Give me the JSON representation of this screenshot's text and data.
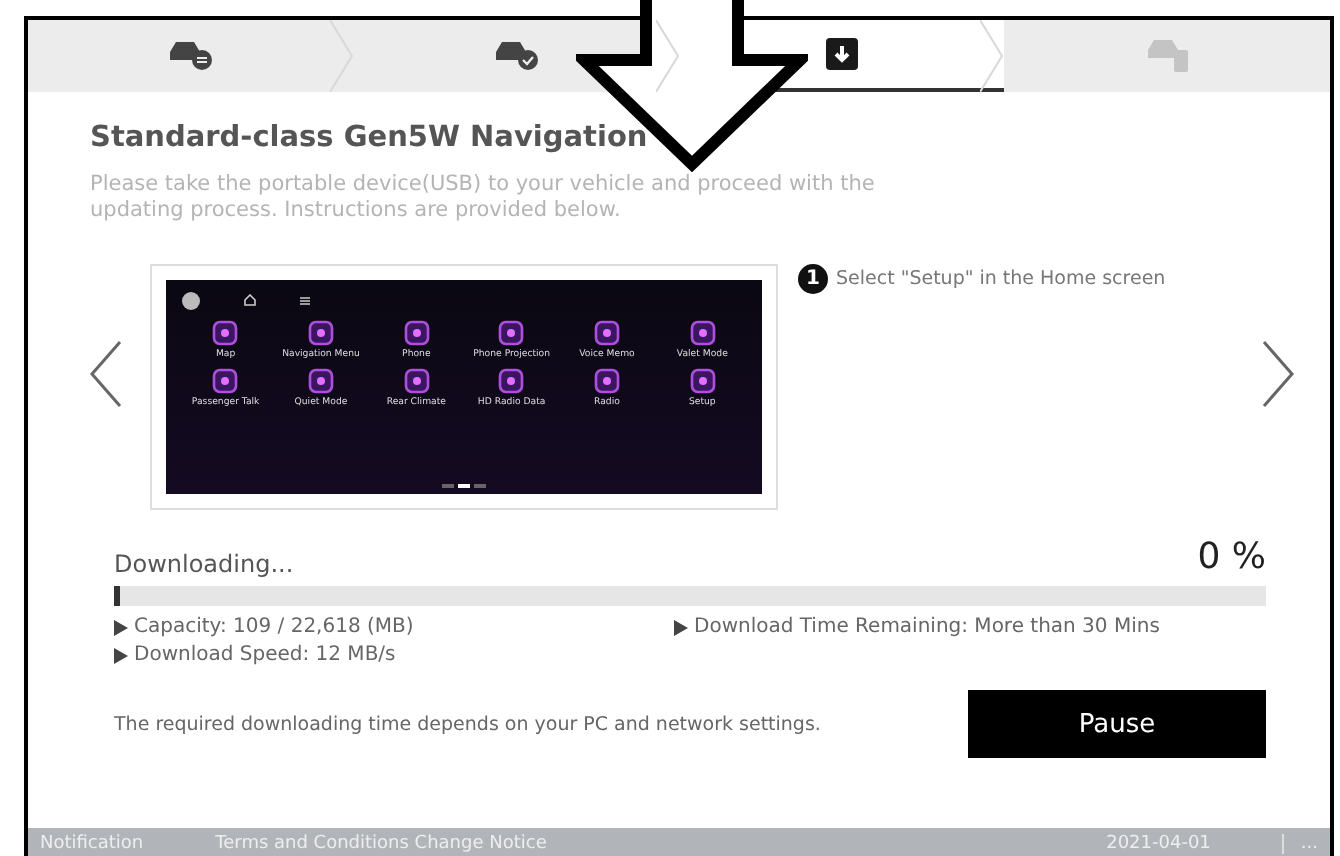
{
  "steps": [
    {
      "kind": "car-sync",
      "selected": false,
      "disabled": false
    },
    {
      "kind": "car-check",
      "selected": false,
      "disabled": false
    },
    {
      "kind": "download",
      "selected": true,
      "disabled": false
    },
    {
      "kind": "car-phone",
      "selected": false,
      "disabled": true
    }
  ],
  "title": "Standard-class Gen5W Navigation",
  "description": "Please take the portable device(USB) to your vehicle and proceed with the updating process. Instructions are provided below.",
  "carousel": {
    "apps": [
      {
        "label": "Map"
      },
      {
        "label": "Navigation Menu"
      },
      {
        "label": "Phone"
      },
      {
        "label": "Phone Projection"
      },
      {
        "label": "Voice Memo"
      },
      {
        "label": "Valet Mode"
      },
      {
        "label": "Passenger Talk"
      },
      {
        "label": "Quiet Mode"
      },
      {
        "label": "Rear Climate"
      },
      {
        "label": "HD Radio Data"
      },
      {
        "label": "Radio"
      },
      {
        "label": "Setup"
      }
    ],
    "pages": [
      {
        "selected": false
      },
      {
        "selected": true
      },
      {
        "selected": false
      }
    ],
    "instruction": {
      "number": "1",
      "text": "Select \"Setup\" in the Home screen"
    }
  },
  "download": {
    "label": "Downloading...",
    "percent": "0 %",
    "level": 0.005,
    "details": [
      "Capacity: 109 / 22,618 (MB)",
      "Download Time Remaining: More than 30 Mins",
      "Download Speed: 12 MB/s"
    ],
    "note": "The required downloading time depends on your PC and network settings.",
    "button": "Pause"
  },
  "footer": {
    "links": [
      "Notification",
      "Terms and Conditions Change Notice"
    ],
    "date": "2021-04-01",
    "more": "..."
  }
}
